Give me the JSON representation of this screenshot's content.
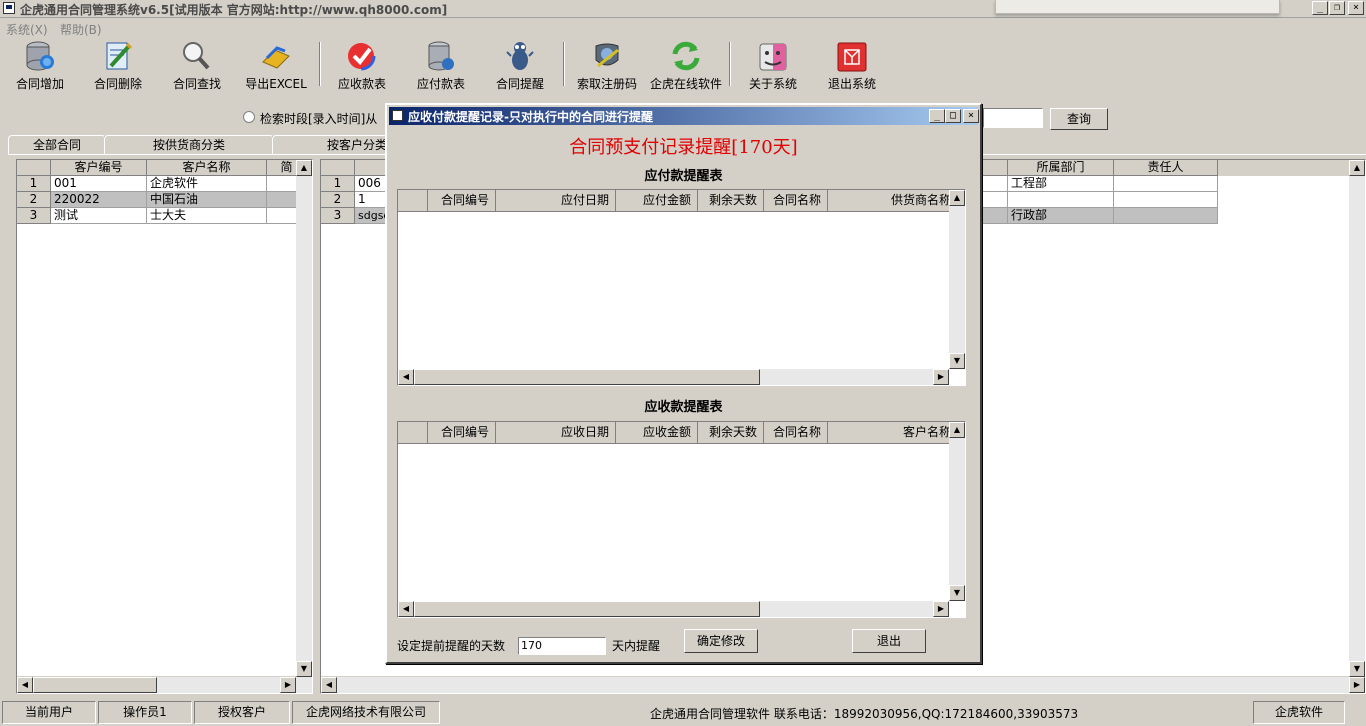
{
  "window": {
    "title": "企虎通用合同管理系统v6.5[试用版本 官方网站:http://www.qh8000.com]"
  },
  "menu": [
    {
      "label": "系统(X)"
    },
    {
      "label": "帮助(B)"
    }
  ],
  "toolbar": [
    {
      "label": "合同增加",
      "icon": "database-add-icon"
    },
    {
      "label": "合同删除",
      "icon": "document-delete-icon"
    },
    {
      "label": "合同查找",
      "icon": "magnifier-icon"
    },
    {
      "label": "导出EXCEL",
      "icon": "export-icon"
    },
    {
      "label": "应收款表",
      "icon": "checkmark-icon"
    },
    {
      "label": "应付款表",
      "icon": "database-icon"
    },
    {
      "label": "合同提醒",
      "icon": "bug-reminder-icon"
    },
    {
      "label": "索取注册码",
      "icon": "register-icon"
    },
    {
      "label": "企虎在线软件",
      "icon": "refresh-icon"
    },
    {
      "label": "关于系统",
      "icon": "finder-icon"
    },
    {
      "label": "退出系统",
      "icon": "exit-cube-icon"
    }
  ],
  "search": {
    "label": "检索时段[录入时间]从",
    "button": "查询"
  },
  "tabs": [
    {
      "label": "全部合同"
    },
    {
      "label": "按供货商分类"
    },
    {
      "label": "按客户分类"
    }
  ],
  "left_grid": {
    "columns": [
      "客户编号",
      "客户名称",
      "简"
    ],
    "rows": [
      {
        "num": "1",
        "id": "001",
        "name": "企虎软件"
      },
      {
        "num": "2",
        "id": "220022",
        "name": "中国石油"
      },
      {
        "num": "3",
        "id": "测试",
        "name": "士大夫"
      }
    ]
  },
  "right_grid": {
    "columns": [
      "所属部门",
      "责任人"
    ],
    "rows": [
      {
        "num": "1",
        "id": "006",
        "dept": "工程部"
      },
      {
        "num": "2",
        "id": "1",
        "dept": ""
      },
      {
        "num": "3",
        "id": "sdgsd",
        "dept": "行政部"
      }
    ]
  },
  "dialog": {
    "title": "应收付款提醒记录-只对执行中的合同进行提醒",
    "heading": "合同预支付记录提醒[170天]",
    "payable_title": "应付款提醒表",
    "payable_columns": [
      "合同编号",
      "应付日期",
      "应付金额",
      "剩余天数",
      "合同名称",
      "供货商名称"
    ],
    "receivable_title": "应收款提醒表",
    "receivable_columns": [
      "合同编号",
      "应收日期",
      "应收金额",
      "剩余天数",
      "合同名称",
      "客户名称"
    ],
    "days_label": "设定提前提醒的天数",
    "days_value": "170",
    "days_suffix": "天内提醒",
    "confirm_button": "确定修改",
    "exit_button": "退出"
  },
  "statusbar": {
    "user": "当前用户",
    "operator": "操作员1",
    "auth": "授权客户",
    "company": "企虎网络技术有限公司",
    "info": "企虎通用合同管理软件   联系电话：18992030956,QQ:172184600,33903573",
    "brand": "企虎软件"
  }
}
